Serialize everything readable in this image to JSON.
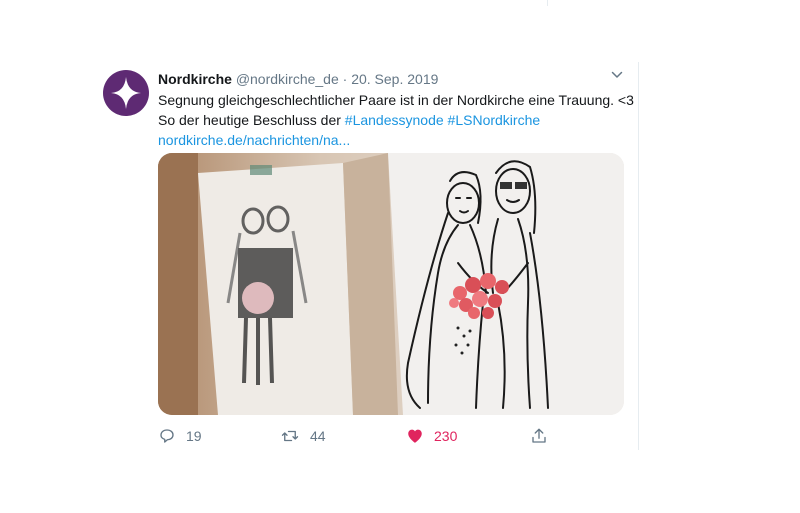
{
  "tweet": {
    "author_name": "Nordkirche",
    "handle": "@nordkirche_de",
    "separator": "·",
    "date": "20. Sep. 2019",
    "text_line1": "Segnung gleichgeschlechtlicher Paare ist in der Nordkirche eine Trauung. <3",
    "text_line2_prefix": "So der heutige Beschluss der ",
    "hashtag1": "#Landessynode",
    "hashtag2": "#LSNordkirche",
    "link": "nordkirche.de/nachrichten/na...",
    "image_description_alt": "Illustration of two brides holding a red rose bouquet",
    "replies": "19",
    "retweets": "44",
    "likes": "230"
  },
  "colors": {
    "avatar_bg": "#5e2a73",
    "link": "#1b95e0",
    "like": "#e0245e",
    "meta": "#657786"
  },
  "icons": [
    "cross-logo-icon",
    "chevron-down-icon",
    "reply-icon",
    "retweet-icon",
    "heart-icon",
    "share-icon"
  ]
}
